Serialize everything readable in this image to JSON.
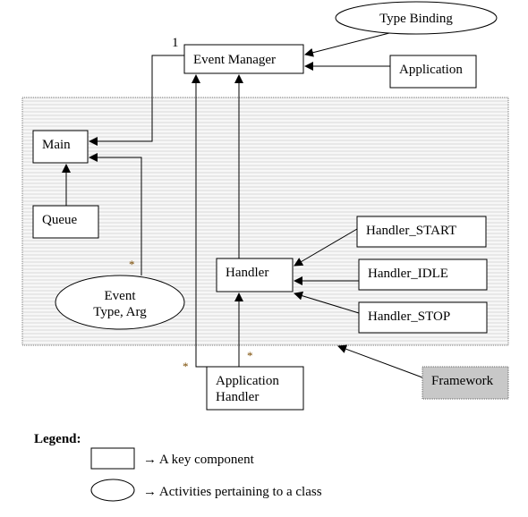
{
  "nodes": {
    "type_binding": "Type Binding",
    "event_manager": "Event Manager",
    "application": "Application",
    "main": "Main",
    "queue": "Queue",
    "handler": "Handler",
    "handler_start": "Handler_START",
    "handler_idle": "Handler_IDLE",
    "handler_stop": "Handler_STOP",
    "event_line1": "Event",
    "event_line2": "Type, Arg",
    "app_handler_line1": "Application",
    "app_handler_line2": "Handler",
    "framework": "Framework"
  },
  "multiplicities": {
    "one": "1",
    "many": "*"
  },
  "legend": {
    "title": "Legend:",
    "box_desc": "→ A key component",
    "ellipse_desc": "→ Activities pertaining to a class"
  },
  "colors": {
    "framework_fill": "#c8c8c8",
    "region_stripe": "#e6e6e6"
  }
}
